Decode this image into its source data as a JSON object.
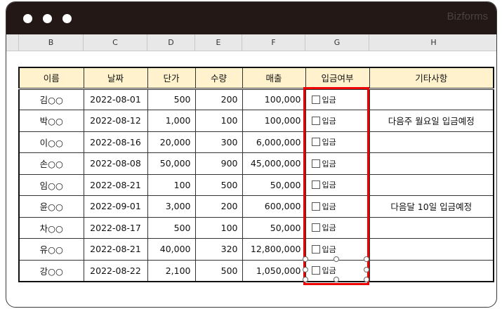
{
  "window": {
    "brand": "Bizforms"
  },
  "columns": [
    "B",
    "C",
    "D",
    "E",
    "F",
    "G",
    "H"
  ],
  "table": {
    "headers": [
      "이름",
      "날짜",
      "단가",
      "수량",
      "매출",
      "입금여부",
      "기타사항"
    ],
    "checkbox_label": "입금",
    "rows": [
      {
        "name": "김○○",
        "date": "2022-08-01",
        "price": "500",
        "qty": "200",
        "sales": "100,000",
        "note": ""
      },
      {
        "name": "박○○",
        "date": "2022-08-12",
        "price": "1,000",
        "qty": "100",
        "sales": "100,000",
        "note": "다음주 월요일 입금예정"
      },
      {
        "name": "이○○",
        "date": "2022-08-16",
        "price": "20,000",
        "qty": "300",
        "sales": "6,000,000",
        "note": ""
      },
      {
        "name": "손○○",
        "date": "2022-08-08",
        "price": "50,000",
        "qty": "900",
        "sales": "45,000,000",
        "note": ""
      },
      {
        "name": "임○○",
        "date": "2022-08-21",
        "price": "100",
        "qty": "500",
        "sales": "50,000",
        "note": ""
      },
      {
        "name": "윤○○",
        "date": "2022-09-01",
        "price": "3,000",
        "qty": "200",
        "sales": "600,000",
        "note": "다음달 10일 입금예정"
      },
      {
        "name": "차○○",
        "date": "2022-08-17",
        "price": "500",
        "qty": "100",
        "sales": "50,000",
        "note": ""
      },
      {
        "name": "유○○",
        "date": "2022-08-21",
        "price": "40,000",
        "qty": "320",
        "sales": "12,800,000",
        "note": ""
      },
      {
        "name": "강○○",
        "date": "2022-08-22",
        "price": "2,100",
        "qty": "500",
        "sales": "1,050,000",
        "note": ""
      }
    ]
  }
}
